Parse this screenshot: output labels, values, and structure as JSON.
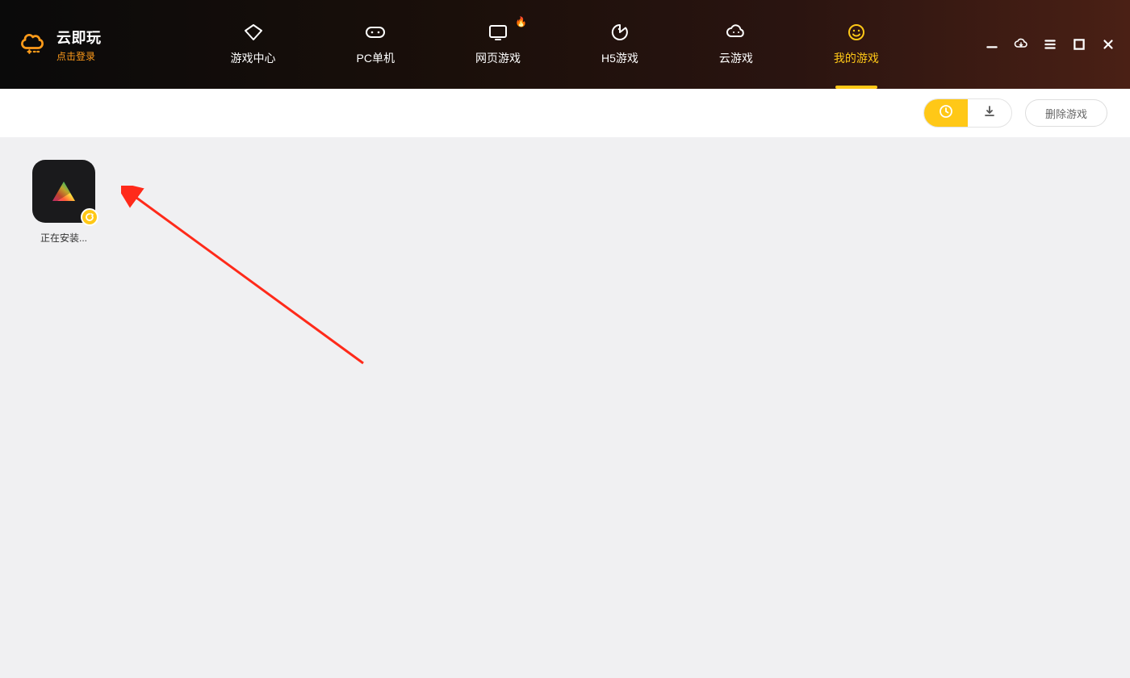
{
  "brand": {
    "name": "云即玩",
    "login_prompt": "点击登录"
  },
  "nav": {
    "tabs": [
      {
        "label": "游戏中心",
        "icon": "diamond",
        "active": false,
        "hot": false
      },
      {
        "label": "PC单机",
        "icon": "gamepad",
        "active": false,
        "hot": false
      },
      {
        "label": "网页游戏",
        "icon": "monitor",
        "active": false,
        "hot": true
      },
      {
        "label": "H5游戏",
        "icon": "pacman",
        "active": false,
        "hot": false
      },
      {
        "label": "云游戏",
        "icon": "cloud-gamepad",
        "active": false,
        "hot": false
      },
      {
        "label": "我的游戏",
        "icon": "smiley",
        "active": true,
        "hot": false
      }
    ],
    "hot_emoji": "🔥"
  },
  "toolbar": {
    "delete_label": "删除游戏",
    "toggle": {
      "active": "recent"
    }
  },
  "apps": [
    {
      "label": "正在安装..."
    }
  ],
  "colors": {
    "accent": "#ffc817",
    "accent_orange": "#ff9b1a",
    "bg": "#f0f0f2",
    "header_dark": "#0a0a0a"
  }
}
